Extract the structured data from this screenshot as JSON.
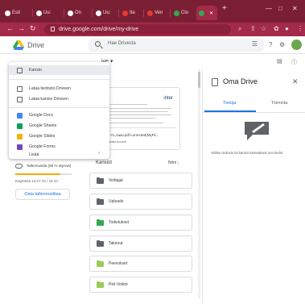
{
  "browser": {
    "tabs": [
      {
        "label": "Esit",
        "color": "#ffffff"
      },
      {
        "label": "Uu:",
        "color": "#ffffff"
      },
      {
        "label": "On",
        "color": "#ffffff"
      },
      {
        "label": "Uu:",
        "color": "#ffffff"
      },
      {
        "label": "Ita",
        "color": "#e53935"
      },
      {
        "label": "Ven",
        "color": "#e53935"
      },
      {
        "label": "Clo",
        "color": "#34a853"
      },
      {
        "label": "",
        "color": "#34a853"
      }
    ],
    "new_tab": "+",
    "url": "drive.google.com/drive/my-drive"
  },
  "header": {
    "app_name": "Drive",
    "search_placeholder": "Hae Drivesta"
  },
  "main": {
    "title_fragment": "ive ▾",
    "preview": {
      "badge": "inter",
      "file_name": "ceit-YL,saav.pdf-corrected(MyFil...",
      "subtitle": "Ystäväsi kuuvia"
    },
    "section_title": "Kansiot",
    "sort_label": "Nimi",
    "folders": [
      {
        "name": "Veittajat",
        "color": "#5f6368"
      },
      {
        "name": "Uploads",
        "color": "#5f6368"
      },
      {
        "name": "Todistukset",
        "color": "#34a853"
      },
      {
        "name": "Takeout",
        "color": "#5f6368"
      },
      {
        "name": "Peevokset",
        "color": "#9bcb56"
      },
      {
        "name": "Peli-Veikot",
        "color": "#9bcb56"
      }
    ]
  },
  "storage": {
    "label": "Tallennustila (80 % täynnä)",
    "used_fraction": 0.8,
    "used_text": "Käytössä 12,07 Gt / 15 Gt",
    "buy_label": "Osta tallennustilaa"
  },
  "menu": {
    "items": [
      {
        "label": "Kansio",
        "icon": "folder-icon",
        "color": "#5f6368"
      },
      {
        "label": "Lataa tiedosto Driveen",
        "icon": "file-upload-icon",
        "color": "#5f6368"
      },
      {
        "label": "Lataa kansio Driveen",
        "icon": "folder-upload-icon",
        "color": "#5f6368"
      },
      {
        "label": "Google Docs",
        "icon": "google-docs-icon",
        "color": "#4285f4"
      },
      {
        "label": "Google Sheets",
        "icon": "google-sheets-icon",
        "color": "#0f9d58"
      },
      {
        "label": "Google Slides",
        "icon": "google-slides-icon",
        "color": "#f4b400"
      },
      {
        "label": "Google Forms",
        "icon": "google-forms-icon",
        "color": "#7248b9"
      },
      {
        "label": "Lisää",
        "icon": "more-icon",
        "color": "#5f6368"
      }
    ]
  },
  "panel": {
    "title": "Oma Drive",
    "tabs": [
      "Tietoja",
      "Toiminta"
    ],
    "empty_text": "Valitse tiedosto tai kansio katsoaksesi sen tiedot"
  },
  "colors": {
    "browser_frame": "#7a1f33",
    "browser_toolbar": "#a42a49",
    "accent": "#1a73e8",
    "storage_bar": "#f9ab00"
  }
}
